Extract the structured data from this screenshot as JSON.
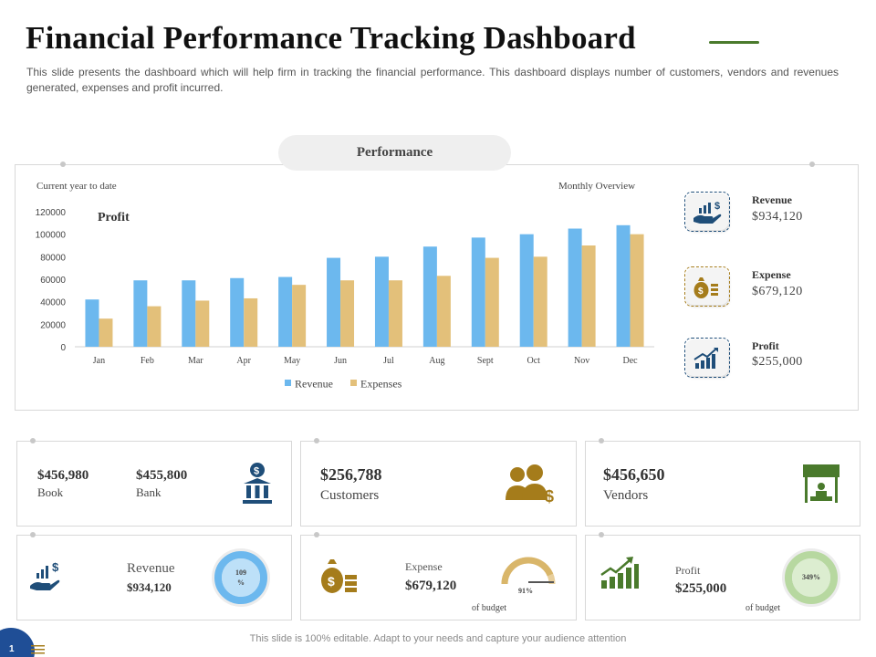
{
  "header": {
    "title": "Financial Performance Tracking Dashboard",
    "subtitle": "This slide presents the dashboard which will help firm in tracking the financial performance. This dashboard displays number of customers, vendors and revenues generated, expenses and profit incurred."
  },
  "performance": {
    "pill_label": "Performance",
    "left_caption": "Current year to date",
    "right_caption": "Monthly Overview",
    "chart_heading": "Profit"
  },
  "chart_data": {
    "type": "bar",
    "categories": [
      "Jan",
      "Feb",
      "Mar",
      "Apr",
      "May",
      "Jun",
      "Jul",
      "Aug",
      "Sept",
      "Oct",
      "Nov",
      "Dec"
    ],
    "series": [
      {
        "name": "Revenue",
        "color": "#6cb8ee",
        "values": [
          42000,
          59000,
          59000,
          61000,
          62000,
          79000,
          80000,
          89000,
          97000,
          100000,
          105000,
          108000
        ]
      },
      {
        "name": "Expenses",
        "color": "#e3c07a",
        "values": [
          25000,
          36000,
          41000,
          43000,
          55000,
          59000,
          59000,
          63000,
          79000,
          80000,
          90000,
          100000
        ]
      }
    ],
    "yticks": [
      0,
      20000,
      40000,
      60000,
      80000,
      100000,
      120000
    ],
    "ylim": [
      0,
      120000
    ],
    "legend_position": "bottom",
    "grid": false
  },
  "kpis": [
    {
      "title": "Revenue",
      "value": "$934,120",
      "icon": "hand-money-chart-icon",
      "color": "#1f4e79"
    },
    {
      "title": "Expense",
      "value": "$679,120",
      "icon": "money-bag-coins-icon",
      "color": "#a57c1b"
    },
    {
      "title": "Profit",
      "value": "$255,000",
      "icon": "growth-chart-icon",
      "color": "#1f4e79"
    }
  ],
  "cards": {
    "book": {
      "value": "$456,980",
      "label": "Book"
    },
    "bank": {
      "value": "$455,800",
      "label": "Bank",
      "icon": "bank-dollar-icon"
    },
    "customers": {
      "value": "$256,788",
      "label": "Customers",
      "icon": "customers-icon"
    },
    "vendors": {
      "value": "$456,650",
      "label": "Vendors",
      "icon": "vendor-stall-icon"
    },
    "revenue": {
      "label": "Revenue",
      "value": "$934,120",
      "gauge_text": "109\n%",
      "gauge_fraction": 1.0,
      "icon": "hand-money-chart-icon"
    },
    "expense": {
      "label": "Expense",
      "value": "$679,120",
      "gauge_text": "91%",
      "gauge_fraction": 0.91,
      "note": "of budget",
      "icon": "money-bag-coins-icon"
    },
    "profit": {
      "label": "Profit",
      "value": "$255,000",
      "gauge_text": "349%",
      "gauge_fraction": 1.0,
      "note": "of budget",
      "icon": "growth-chart-icon"
    }
  },
  "footer": {
    "text": "This slide is 100% editable. Adapt to your needs and capture your audience attention",
    "page_number": "1"
  }
}
